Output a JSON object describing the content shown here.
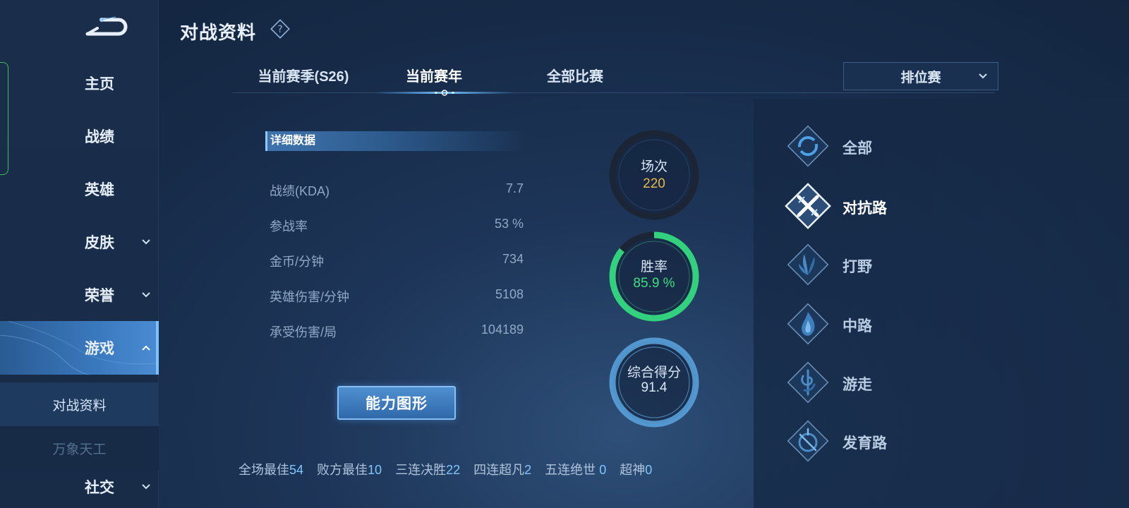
{
  "header": {
    "title": "对战资料"
  },
  "sidebar": {
    "items": [
      {
        "label": "主页",
        "has_chevron": false
      },
      {
        "label": "战绩",
        "has_chevron": false
      },
      {
        "label": "英雄",
        "has_chevron": false
      },
      {
        "label": "皮肤",
        "has_chevron": true
      },
      {
        "label": "荣誉",
        "has_chevron": true
      },
      {
        "label": "游戏",
        "has_chevron": true,
        "active": true
      },
      {
        "label": "社交",
        "has_chevron": true
      }
    ],
    "sub_items": [
      {
        "label": "对战资料",
        "current": true
      },
      {
        "label": "万象天工",
        "current": false
      }
    ]
  },
  "tabs": [
    {
      "label": "当前赛季(S26)"
    },
    {
      "label": "当前赛年",
      "active": true
    },
    {
      "label": "全部比赛"
    }
  ],
  "mode_select": {
    "selected": "排位赛"
  },
  "details": {
    "section_title": "详细数据",
    "rows": [
      {
        "label": "战绩(KDA)",
        "value": "7.7"
      },
      {
        "label": "参战率",
        "value": "53 %"
      },
      {
        "label": "金币/分钟",
        "value": "734"
      },
      {
        "label": "英雄伤害/分钟",
        "value": "5108"
      },
      {
        "label": "承受伤害/局",
        "value": "104189"
      }
    ]
  },
  "ability_button": {
    "label": "能力图形"
  },
  "rings": {
    "matches": {
      "label": "场次",
      "value": "220"
    },
    "win_rate": {
      "label": "胜率",
      "value": "85.9 %",
      "fraction": 0.859
    },
    "score": {
      "label": "综合得分",
      "value": "91.4"
    }
  },
  "bottom_stats": [
    {
      "label": "全场最佳",
      "value": "54"
    },
    {
      "label": "败方最佳",
      "value": "10"
    },
    {
      "label": "三连决胜",
      "value": "22"
    },
    {
      "label": "四连超凡",
      "value": "2"
    },
    {
      "label": "五连绝世 ",
      "value": "0"
    },
    {
      "label": "超神",
      "value": "0"
    }
  ],
  "roles": [
    {
      "label": "全部",
      "icon": "all-icon"
    },
    {
      "label": "对抗路",
      "icon": "crossed-swords-icon",
      "active": true
    },
    {
      "label": "打野",
      "icon": "leaf-icon"
    },
    {
      "label": "中路",
      "icon": "flame-icon"
    },
    {
      "label": "游走",
      "icon": "spiral-icon"
    },
    {
      "label": "发育路",
      "icon": "compass-icon"
    }
  ],
  "colors": {
    "accent_blue": "#4a8cd2",
    "win_green": "#33d07e",
    "matches_gold": "#e6b84a",
    "score_blue": "#5aa6e0"
  }
}
